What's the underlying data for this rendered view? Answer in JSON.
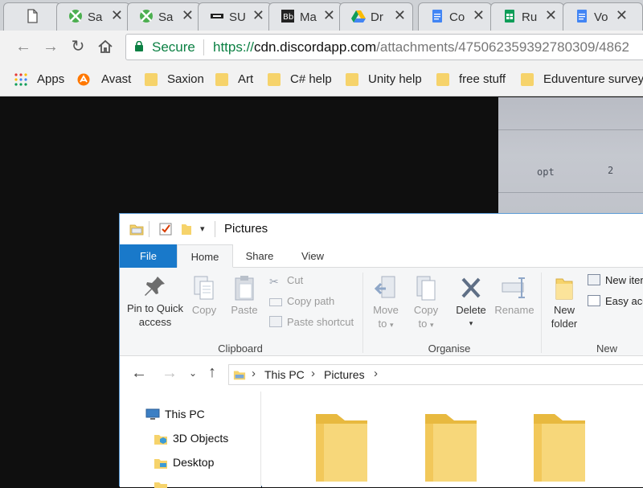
{
  "browser": {
    "tabs": [
      {
        "title": "",
        "icon": "blank-page-icon"
      },
      {
        "title": "Sa",
        "icon": "saxion-icon"
      },
      {
        "title": "Sa",
        "icon": "saxion-icon"
      },
      {
        "title": "SU",
        "icon": "su-icon"
      },
      {
        "title": "Ma",
        "icon": "blackboard-icon"
      },
      {
        "title": "Dr",
        "icon": "google-drive-icon"
      },
      {
        "title": "Co",
        "icon": "google-docs-icon"
      },
      {
        "title": "Ru",
        "icon": "google-sheets-icon"
      },
      {
        "title": "Vo",
        "icon": "google-docs-icon"
      }
    ],
    "secure_label": "Secure",
    "url_scheme": "https://",
    "url_domain": "cdn.discordapp.com",
    "url_path": "/attachments/475062359392780309/4862",
    "bookmarks": [
      {
        "label": "Apps",
        "icon": "apps-grid-icon"
      },
      {
        "label": "Avast",
        "icon": "avast-icon"
      },
      {
        "label": "Saxion",
        "icon": "folder-icon"
      },
      {
        "label": "Art",
        "icon": "folder-icon"
      },
      {
        "label": "C# help",
        "icon": "folder-icon"
      },
      {
        "label": "Unity help",
        "icon": "folder-icon"
      },
      {
        "label": "free stuff",
        "icon": "folder-icon"
      },
      {
        "label": "Eduventure survey",
        "icon": "folder-icon"
      }
    ]
  },
  "photo": {
    "text_a": "opt",
    "text_b": "2"
  },
  "explorer": {
    "title": "Pictures",
    "ribbon_tabs": [
      "File",
      "Home",
      "Share",
      "View"
    ],
    "clipboard": {
      "pin_label_1": "Pin to Quick",
      "pin_label_2": "access",
      "copy": "Copy",
      "paste": "Paste",
      "cut": "Cut",
      "copy_path": "Copy path",
      "paste_shortcut": "Paste shortcut",
      "group": "Clipboard"
    },
    "organise": {
      "move_to_1": "Move",
      "move_to_2": "to",
      "copy_to_1": "Copy",
      "copy_to_2": "to",
      "delete": "Delete",
      "rename": "Rename",
      "group": "Organise"
    },
    "new": {
      "new_folder_1": "New",
      "new_folder_2": "folder",
      "new_item": "New iten",
      "easy_access": "Easy acc",
      "group": "New"
    },
    "breadcrumb": [
      "This PC",
      "Pictures"
    ],
    "tree": [
      {
        "label": "This PC",
        "icon": "this-pc-icon"
      },
      {
        "label": "3D Objects",
        "icon": "3d-objects-folder-icon"
      },
      {
        "label": "Desktop",
        "icon": "desktop-folder-icon"
      }
    ],
    "colors": {
      "accent": "#1979ca",
      "folder": "#f6d36b",
      "secure": "#0b8043"
    }
  }
}
